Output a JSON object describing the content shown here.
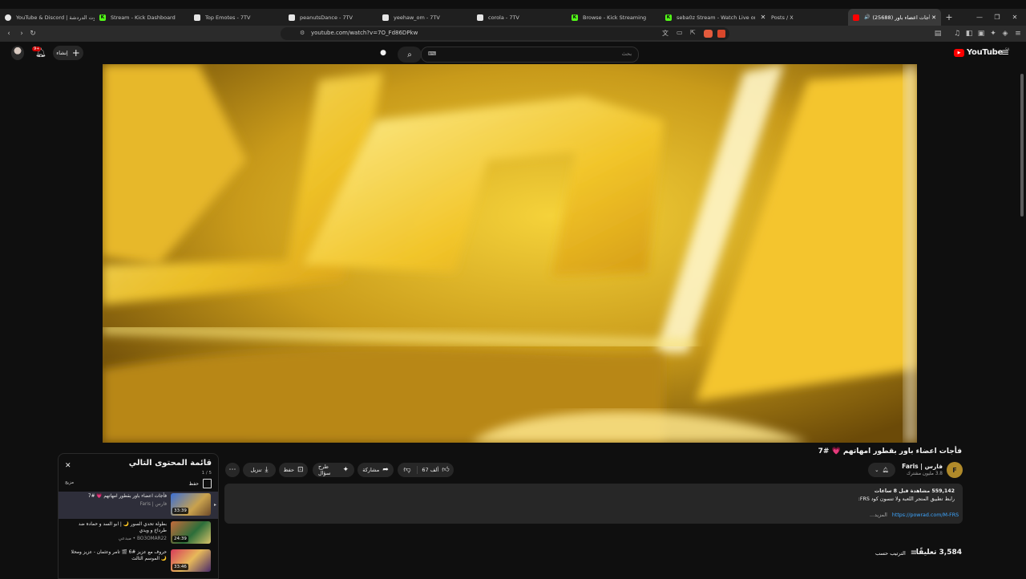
{
  "browser": {
    "tabs": [
      {
        "label": "YouTube & Discord | بوت الدردشة",
        "icon": "discord-icon",
        "color": "#e6e6e6"
      },
      {
        "label": "Stream - Kick Dashboard",
        "icon": "kick-icon",
        "color": "#53fc18"
      },
      {
        "label": "Top Emotes - 7TV",
        "icon": "7tv-icon",
        "color": "#e6e6e6"
      },
      {
        "label": "peanutsDance - 7TV",
        "icon": "7tv-icon",
        "color": "#e6e6e6"
      },
      {
        "label": "yeehaw_om - 7TV",
        "icon": "7tv-icon",
        "color": "#e6e6e6"
      },
      {
        "label": "corola - 7TV",
        "icon": "7tv-icon",
        "color": "#e6e6e6"
      },
      {
        "label": "Browse - Kick Streaming",
        "icon": "kick-icon",
        "color": "#53fc18"
      },
      {
        "label": "seba0z Stream - Watch Live on Ki",
        "icon": "kick-icon",
        "color": "#53fc18"
      },
      {
        "label": "Posts / X",
        "icon": "x-icon",
        "color": "#e6e6e6"
      },
      {
        "label": "(25688) فأجات اعضاء باور",
        "icon": "youtube-icon",
        "color": "#ff0000"
      }
    ],
    "url": "youtube.com/watch?v=7O_Fd86DPkw"
  },
  "header": {
    "create_label": "إنشاء",
    "notification_badge": "9+",
    "search_placeholder": "بحث",
    "logo_text": "YouTube",
    "region": "SA"
  },
  "video": {
    "title": "فأجات اعضاء باور بقطور امهاتهم 💗 #7",
    "channel_name": "فارس | Faris",
    "subscribers": "3.8 مليون مشترك",
    "like_count": "67 ألف",
    "actions": {
      "share": "مشاركة",
      "ask": "طرح سؤال",
      "save": "حفظ",
      "download": "تنزيل"
    },
    "description": {
      "stats": "559,142 مشاهدة قبل 8 ساعات",
      "line1": "رابط تطبيق المتجر اللعبة ولا تنسون كود FRS:",
      "link": "https://powrad.com/M-FRS",
      "more": "...المزيد"
    },
    "comments_count": "3,584 تعليقًا",
    "sort_label": "الترتيب حسب"
  },
  "playlist": {
    "title": "قائمة المحتوى التالي",
    "position": "1 / 5",
    "save_label": "حفظ",
    "mix_label": "مزيج",
    "items": [
      {
        "title": "فأجات اعضاء باور بقطور امهاتهم 💗 #7",
        "channel": "فارس | Faris",
        "duration": "33:39"
      },
      {
        "title": "بطولة تحدي السور 🌙 | ابو السد و حمادة ضد طرداخ و ويدي",
        "channel": "BO3OMAR22 • مبدعي",
        "duration": "24:39"
      },
      {
        "title": "حروف مع عزيز #6 🎬 تامر وعثمان - عزيز ومحلا 🌙 الموسم الثالث",
        "channel": "",
        "duration": "33:46"
      }
    ]
  }
}
